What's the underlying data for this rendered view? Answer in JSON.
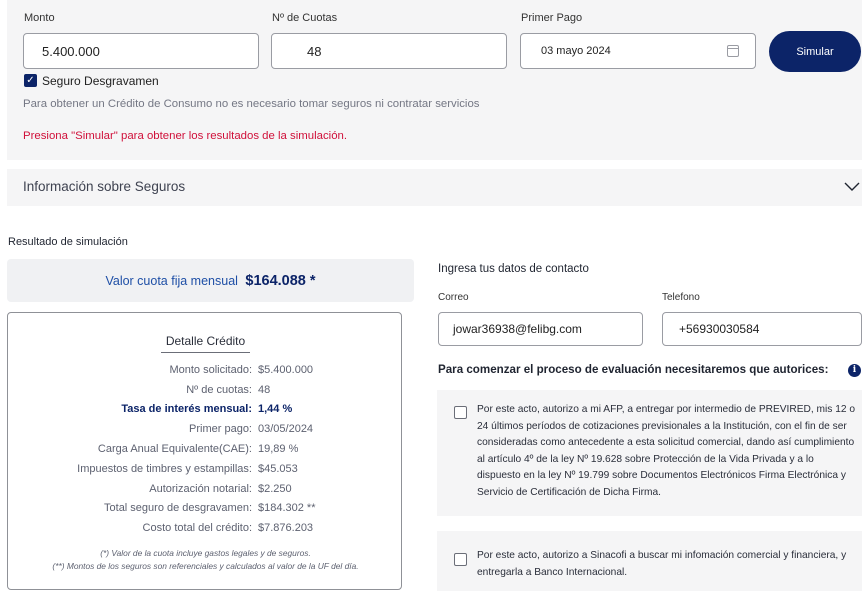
{
  "simulator": {
    "amount_label": "Monto",
    "amount_value": "5.400.000",
    "installments_label": "Nº de Cuotas",
    "installments_value": "48",
    "first_payment_label": "Primer Pago",
    "first_payment_value": "03 mayo 2024",
    "simulate_button": "Simular",
    "insurance_checkbox_label": "Seguro Desgravamen",
    "insurance_checked": true,
    "disclaimer": "Para obtener un Crédito de Consumo no es necesario tomar seguros ni contratar servicios",
    "prompt": "Presiona \"Simular\" para obtener los resultados de la simulación."
  },
  "insurance_info": {
    "title": "Información sobre Seguros"
  },
  "result": {
    "title": "Resultado de simulación",
    "quota_label": "Valor cuota fija mensual",
    "quota_value": "$164.088 *",
    "detail": {
      "title": "Detalle Crédito",
      "rows": [
        {
          "label": "Monto solicitado:",
          "value": "$5.400.000"
        },
        {
          "label": "Nº de cuotas:",
          "value": "48"
        },
        {
          "label": "Tasa de interés mensual:",
          "value": "1,44 %"
        },
        {
          "label": "Primer pago:",
          "value": "03/05/2024"
        },
        {
          "label": "Carga Anual Equivalente(CAE):",
          "value": "19,89 %"
        },
        {
          "label": "Impuestos de timbres y estampillas:",
          "value": "$45.053"
        },
        {
          "label": "Autorización notarial:",
          "value": "$2.250"
        },
        {
          "label": "Total seguro de desgravamen:",
          "value": "$184.302 **"
        },
        {
          "label": "Costo total del crédito:",
          "value": "$7.876.203"
        }
      ],
      "footnote_1": "(*) Valor de la cuota incluye gastos legales y de seguros.",
      "footnote_2": "(**) Montos de los seguros son referenciales y calculados al valor de la UF del día."
    }
  },
  "contact": {
    "title": "Ingresa tus datos de contacto",
    "email_label": "Correo",
    "email_value": "jowar36938@felibg.com",
    "phone_label": "Telefono",
    "phone_value": "+56930030584",
    "authorization_title": "Para comenzar el proceso de evaluación necesitaremos que autorices:",
    "consent_1": "Por este acto, autorizo a mi AFP, a entregar por intermedio de PREVIRED, mis 12 o 24 últimos períodos de cotizaciones previsionales a la Institución, con el fin de ser consideradas como antecedente a esta solicitud comercial, dando así cumplimiento al artículo 4º de la ley Nº 19.628 sobre Protección de la Vida Privada y a lo dispuesto en la ley Nº 19.799 sobre Documentos Electrónicos Firma Electrónica y Servicio de Certificación de Dicha Firma.",
    "consent_2": "Por este acto, autorizo a Sinacofi a buscar mi infomación comercial y financiera, y entregarla a Banco Internacional."
  },
  "colors": {
    "primary_navy": "#0c2468",
    "alert_red": "#d0103a",
    "panel_gray": "#f5f5f6",
    "info_blue": "#1565c0"
  }
}
